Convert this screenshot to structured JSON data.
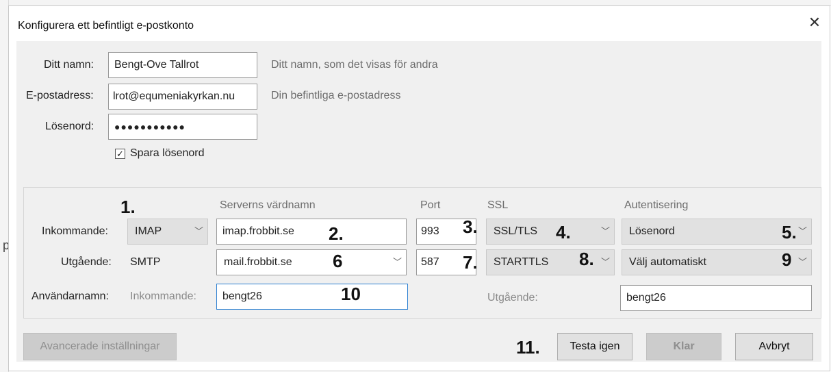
{
  "background": {
    "edge_char": "p"
  },
  "dialog": {
    "title": "Konfigurera ett befintligt e-postkonto",
    "close_icon": "close-icon"
  },
  "account": {
    "name_label": "Ditt namn:",
    "name_value": "Bengt-Ove Tallrot",
    "name_hint": "Ditt namn, som det visas för andra",
    "email_label": "E-postadress:",
    "email_value": "lrot@equmeniakyrkan.nu",
    "email_hint": "Din befintliga e-postadress",
    "password_label": "Lösenord:",
    "password_value": "●●●●●●●●●●●",
    "save_password_label": "Spara lösenord",
    "save_password_checked": true
  },
  "server": {
    "headers": {
      "hostname": "Serverns värdnamn",
      "port": "Port",
      "ssl": "SSL",
      "auth": "Autentisering"
    },
    "incoming": {
      "label": "Inkommande:",
      "protocol": "IMAP",
      "hostname": "imap.frobbit.se",
      "port": "993",
      "ssl": "SSL/TLS",
      "auth": "Lösenord"
    },
    "outgoing": {
      "label": "Utgående:",
      "protocol": "SMTP",
      "hostname": "mail.frobbit.se",
      "port": "587",
      "ssl": "STARTTLS",
      "auth": "Välj automatiskt"
    },
    "username": {
      "label": "Användarnamn:",
      "incoming_label": "Inkommande:",
      "incoming_value": "bengt26",
      "outgoing_label": "Utgående:",
      "outgoing_value": "bengt26"
    }
  },
  "annotations": {
    "n1": "1.",
    "n2": "2.",
    "n3": "3.",
    "n4": "4.",
    "n5": "5.",
    "n6": "6",
    "n7": "7.",
    "n8": "8.",
    "n9": "9",
    "n10": "10",
    "n11": "11."
  },
  "buttons": {
    "advanced": "Avancerade inställningar",
    "retest": "Testa igen",
    "done": "Klar",
    "cancel": "Avbryt"
  }
}
